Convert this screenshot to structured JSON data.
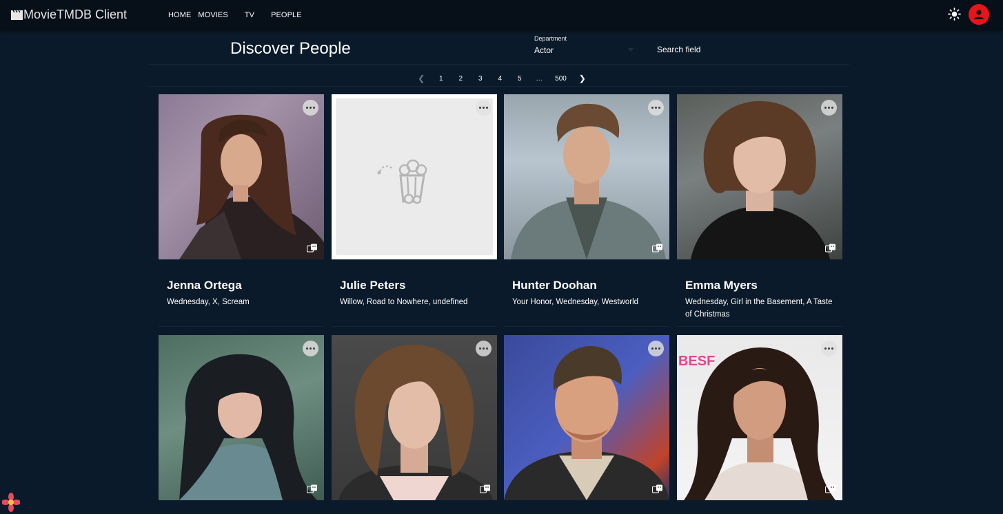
{
  "app": {
    "brand": "MovieTMDB Client",
    "brand_icon": "clapperboard-icon",
    "nav": [
      "HOME",
      "MOVIES",
      "TV",
      "PEOPLE"
    ],
    "theme_icon": "sun-icon",
    "account_icon": "account-circle-icon",
    "accent_color": "#e8141c",
    "background_color": "#0b1a2a"
  },
  "page": {
    "title": "Discover People",
    "department_label": "Department",
    "department_value": "Actor",
    "search_placeholder": "Search field"
  },
  "pagination": {
    "prev_icon": "chevron-left-icon",
    "pages": [
      "1",
      "2",
      "3",
      "4",
      "5"
    ],
    "ellipsis": "…",
    "last_page": "500",
    "next_icon": "chevron-right-icon"
  },
  "people": [
    {
      "name": "Jenna Ortega",
      "known_for": "Wednesday, X, Scream",
      "has_image": true
    },
    {
      "name": "Julie Peters",
      "known_for": "Willow, Road to Nowhere, undefined",
      "has_image": false
    },
    {
      "name": "Hunter Doohan",
      "known_for": "Your Honor, Wednesday, Westworld",
      "has_image": true
    },
    {
      "name": "Emma Myers",
      "known_for": "Wednesday, Girl in the Basement, A Taste of Christmas",
      "has_image": true
    },
    {
      "name": "",
      "known_for": "",
      "has_image": true
    },
    {
      "name": "",
      "known_for": "",
      "has_image": true
    },
    {
      "name": "",
      "known_for": "",
      "has_image": true
    },
    {
      "name": "",
      "known_for": "",
      "has_image": true
    }
  ],
  "card_icons": {
    "more": "more-horizontal-icon",
    "media": "theater-masks-icon"
  },
  "placeholder_icon": "popcorn-icon",
  "photo_backdrop_text": "BESF"
}
